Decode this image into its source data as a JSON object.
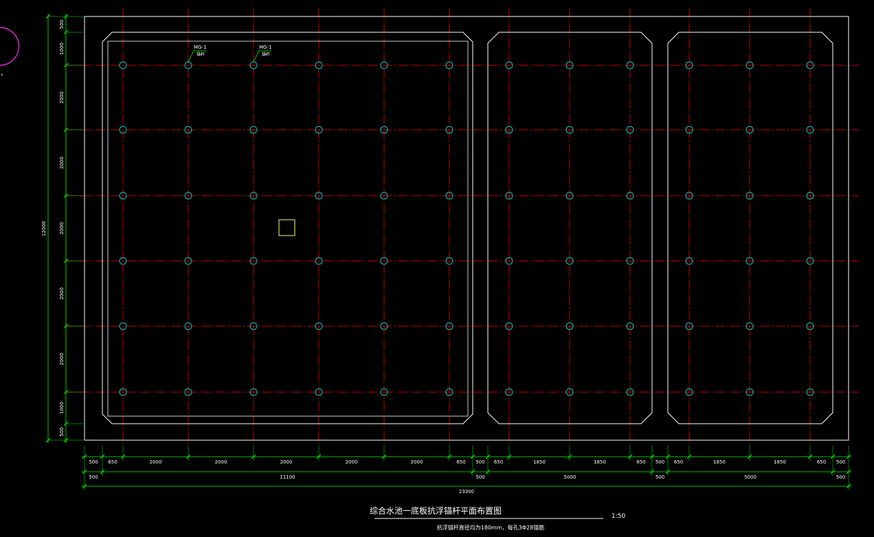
{
  "drawing": {
    "title": "综合水池一底板抗浮锚杆平面布置图",
    "scale": "1:50",
    "note": "抗浮锚杆直径均为180mm，每孔3Φ28锚筋",
    "overall_height": "12000",
    "overall_width": "23300",
    "leader_labels": [
      {
        "code": "MG-1",
        "sub": "锚杆"
      },
      {
        "code": "MG-1",
        "sub": "锚杆"
      }
    ],
    "left_dims": [
      "500",
      "1000",
      "2000",
      "2000",
      "2000",
      "2000",
      "2000",
      "1000",
      "500"
    ],
    "bottom_dims_row1": [
      "500",
      "650",
      "2000",
      "2000",
      "2000",
      "2000",
      "2000",
      "650",
      "500",
      "650",
      "1850",
      "1850",
      "650",
      "500",
      "650",
      "1850",
      "1850",
      "650",
      "500"
    ],
    "bottom_dims_row2": [
      "500",
      "11100",
      "500",
      "5000",
      "500",
      "5000",
      "500"
    ]
  },
  "colors": {
    "background": "#000000",
    "outline": "#ffffff",
    "axis": "#cc0000",
    "anchor": "#00c8c8",
    "dimension": "#00ff00",
    "marker": "#ffff66",
    "arc": "#ff33ff"
  }
}
